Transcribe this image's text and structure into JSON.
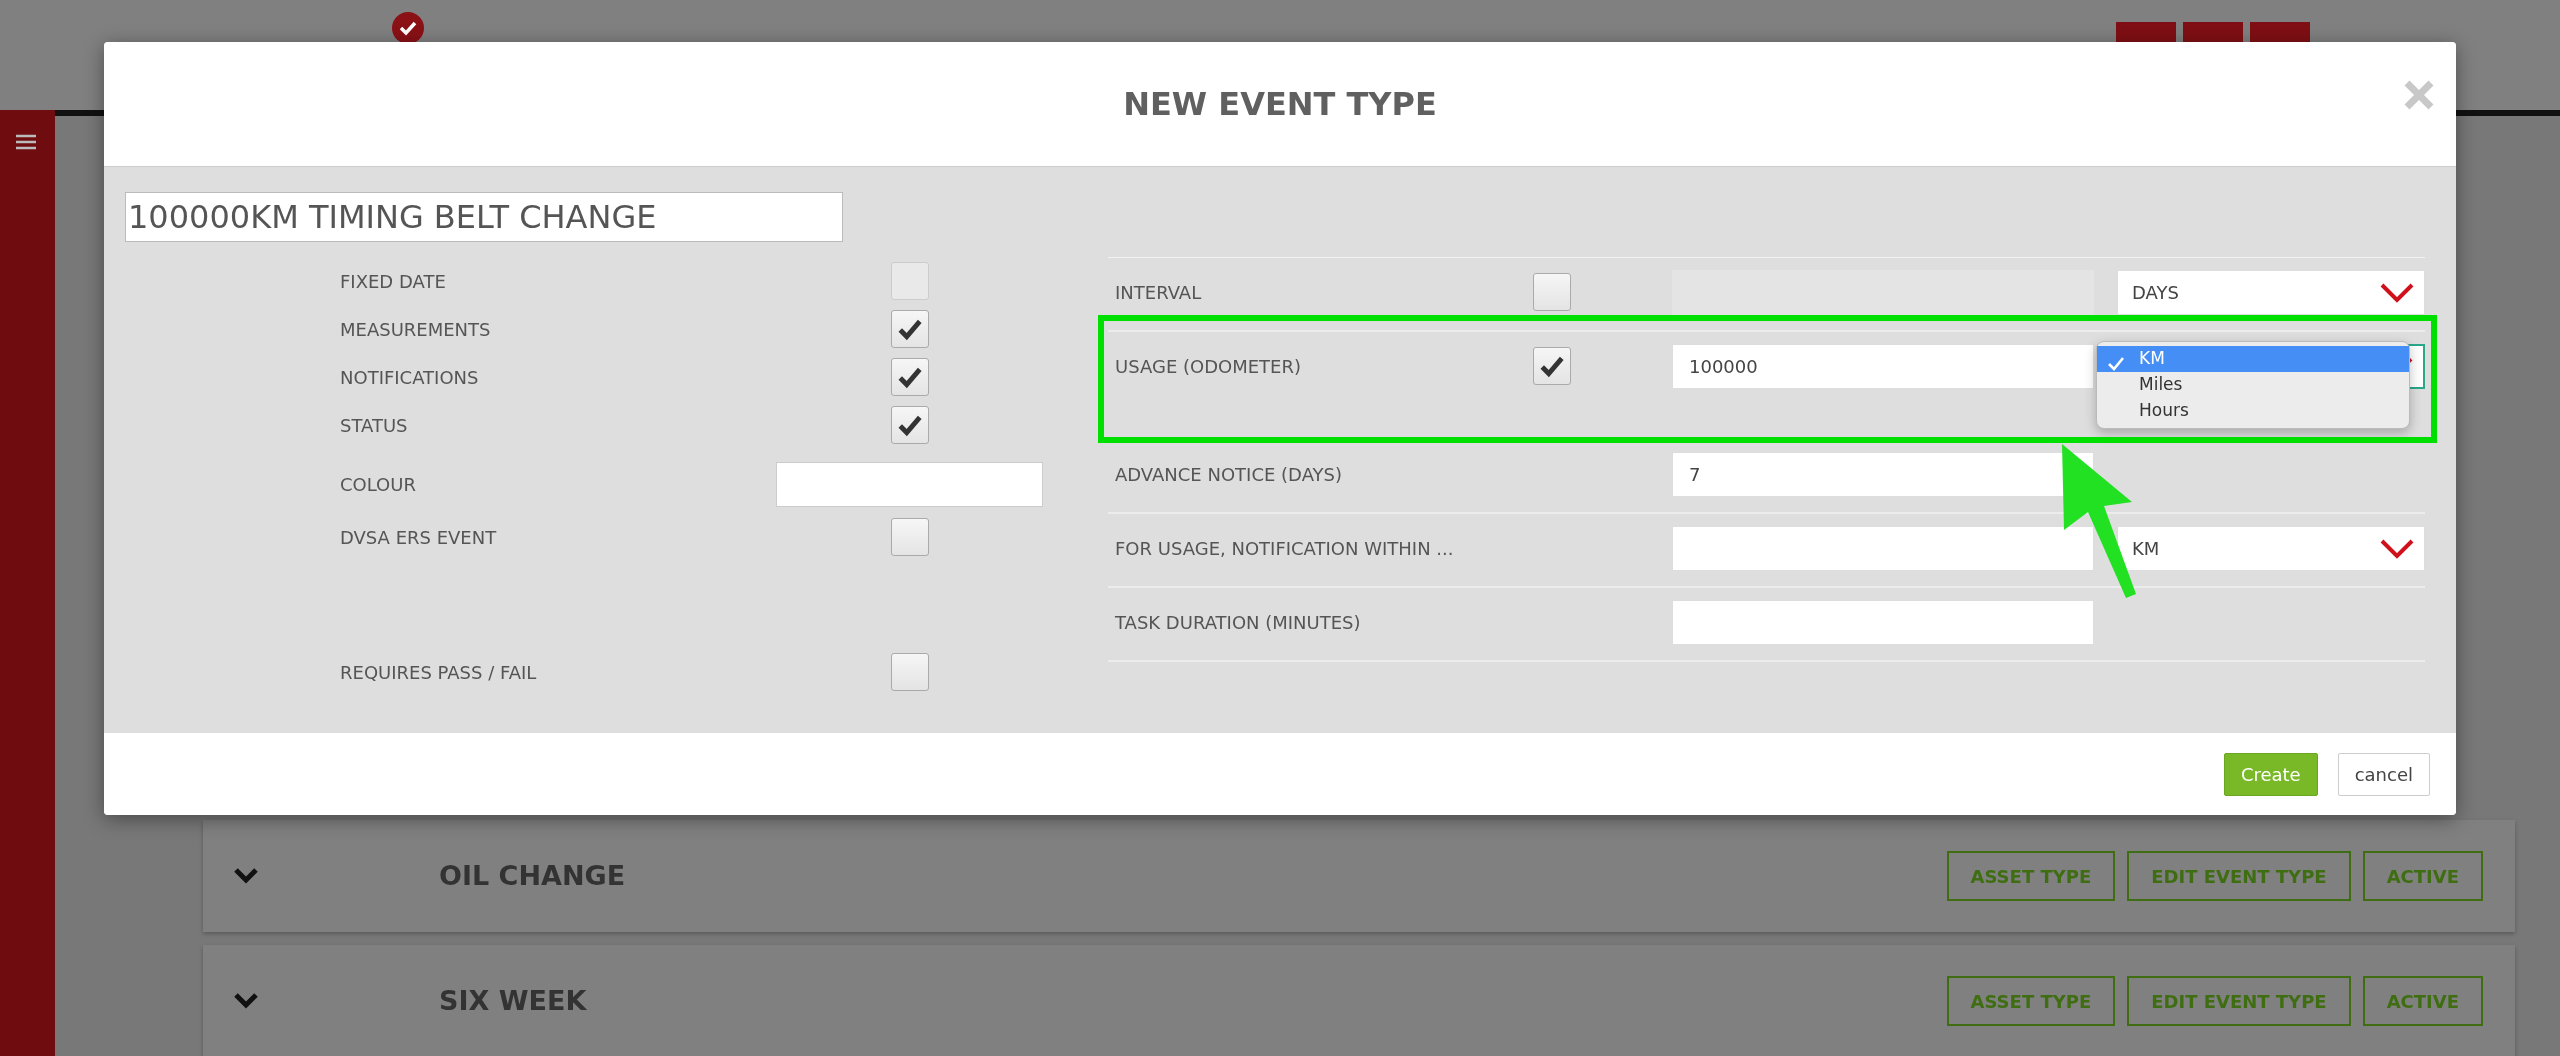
{
  "page": {
    "cards": [
      {
        "title": "OIL CHANGE",
        "buttons": [
          "ASSET TYPE",
          "EDIT EVENT TYPE",
          "ACTIVE"
        ]
      },
      {
        "title": "SIX WEEK",
        "buttons": [
          "ASSET TYPE",
          "EDIT EVENT TYPE",
          "ACTIVE"
        ]
      }
    ]
  },
  "modal": {
    "title": "NEW EVENT TYPE",
    "name": "100000KM TIMING BELT CHANGE",
    "options": [
      {
        "kind": "checkbox",
        "label": "FIXED DATE",
        "checked": false,
        "disabled": true
      },
      {
        "kind": "checkbox",
        "label": "MEASUREMENTS",
        "checked": true,
        "disabled": false
      },
      {
        "kind": "checkbox",
        "label": "NOTIFICATIONS",
        "checked": true,
        "disabled": false
      },
      {
        "kind": "checkbox",
        "label": "STATUS",
        "checked": true,
        "disabled": false
      },
      {
        "kind": "field",
        "label": "COLOUR",
        "disabled": false
      },
      {
        "kind": "checkbox",
        "label": "DVSA ERS EVENT",
        "checked": false,
        "disabled": false
      },
      {
        "kind": "checkbox",
        "label": "REQUIRES PASS / FAIL",
        "checked": false,
        "disabled": false
      }
    ],
    "settings": [
      {
        "label": "INTERVAL",
        "checked": false,
        "input_disabled": true,
        "unit": "DAYS"
      },
      {
        "label": "USAGE (ODOMETER)",
        "checked": true,
        "input_disabled": false,
        "value": "100000",
        "unit_menu": [
          {
            "label": "KM",
            "selected": true
          },
          {
            "label": "Miles",
            "selected": false
          },
          {
            "label": "Hours",
            "selected": false
          }
        ]
      },
      {
        "label": "ADVANCE NOTICE (DAYS)",
        "input_disabled": false,
        "value": "7"
      },
      {
        "label": "FOR USAGE, NOTIFICATION WITHIN ...",
        "input_disabled": false,
        "unit": "KM"
      },
      {
        "label": "TASK DURATION (MINUTES)",
        "input_disabled": false
      }
    ],
    "footer_buttons": [
      {
        "label": "Create",
        "kind": "primary"
      },
      {
        "label": "cancel",
        "kind": "secondary"
      }
    ]
  }
}
